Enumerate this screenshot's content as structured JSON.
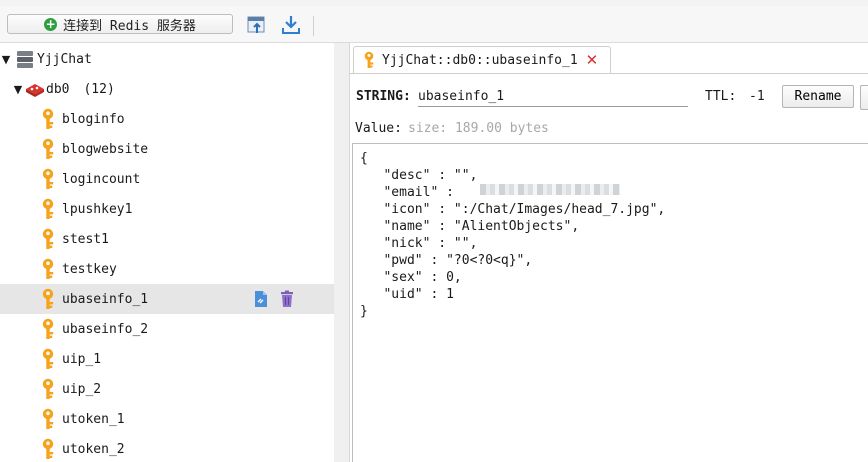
{
  "toolbar": {
    "connect_label": "连接到 Redis 服务器",
    "icons": [
      "plus-circle-icon",
      "import-icon",
      "download-icon"
    ]
  },
  "tree": {
    "server": {
      "name": "YjjChat",
      "icon": "server-icon"
    },
    "db": {
      "name": "db0",
      "count": "(12)",
      "icon": "redis-icon"
    },
    "keys": [
      "bloginfo",
      "blogwebsite",
      "logincount",
      "lpushkey1",
      "stest1",
      "testkey",
      "ubaseinfo_1",
      "ubaseinfo_2",
      "uip_1",
      "uip_2",
      "utoken_1",
      "utoken_2"
    ],
    "selected_key": "ubaseinfo_1",
    "row_action_icons": [
      "copy-link-icon",
      "trash-icon"
    ]
  },
  "tab": {
    "title": "YjjChat::db0::ubaseinfo_1",
    "close_symbol": "✕"
  },
  "detail": {
    "type_label": "STRING:",
    "key_name": "ubaseinfo_1",
    "ttl_label": "TTL:",
    "ttl_value": "-1",
    "rename_label": "Rename",
    "value_label": "Value:",
    "size_label": "size: 189.00 bytes",
    "value_lines": [
      "{",
      "   \"desc\" : \"\",",
      "   \"email\" :",
      "   \"icon\" : \":/Chat/Images/head_7.jpg\",",
      "   \"name\" : \"AlientObjects\",",
      "   \"nick\" : \"\",",
      "   \"pwd\" : \"?0<?0<q}\",",
      "   \"sex\" : 0,",
      "   \"uid\" : 1",
      "}"
    ]
  },
  "colors": {
    "key_icon": "#f6a21b",
    "selected_row": "#e6e6e6",
    "close": "#d83030",
    "redis": "#d9342b"
  }
}
